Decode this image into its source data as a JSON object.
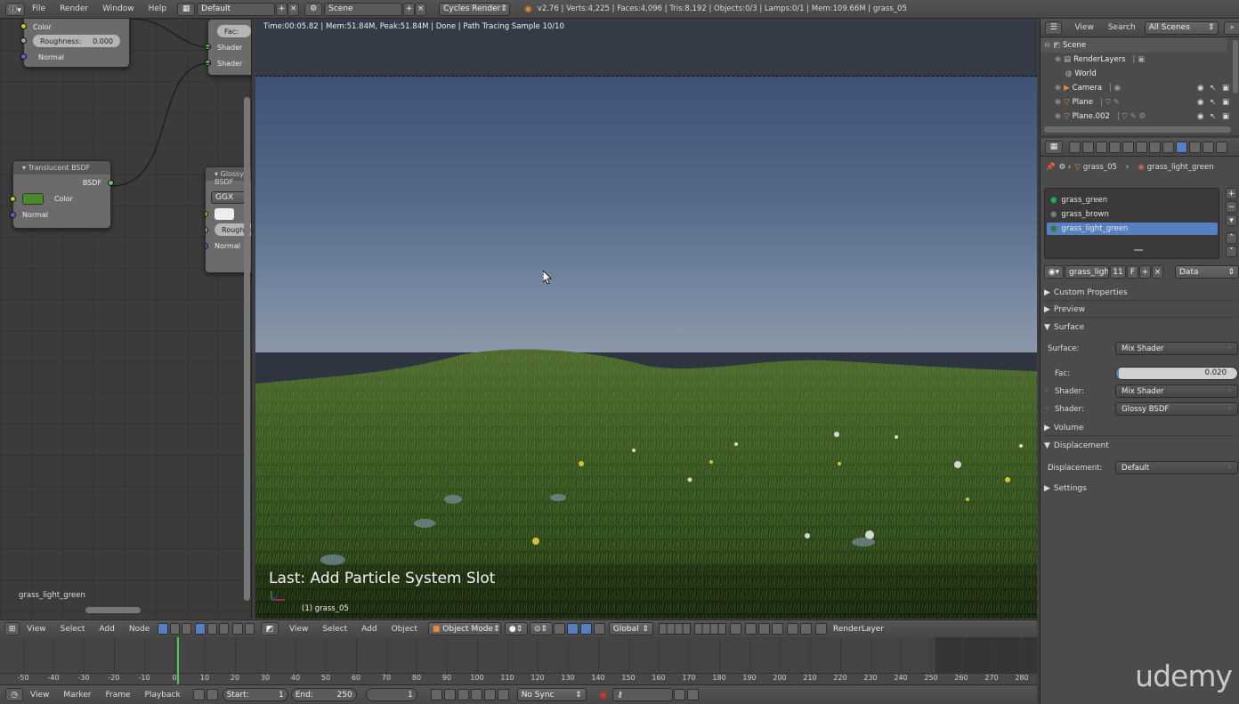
{
  "topbar": {
    "menus": [
      "File",
      "Render",
      "Window",
      "Help"
    ],
    "screen_layout": "Default",
    "scene": "Scene",
    "render_engine": "Cycles Render",
    "stats": "v2.76 | Verts:4,225 | Faces:4,096 | Tris:8,192 | Objects:0/3 | Lamps:0/1 | Mem:109.66M | grass_05"
  },
  "node_editor": {
    "partial_node_1": {
      "color_label": "Color",
      "roughness_label": "Roughness:",
      "roughness_value": "0.000",
      "normal_label": "Normal"
    },
    "mix_node": {
      "fac_label": "Fac:",
      "shader1": "Shader",
      "shader2": "Shader"
    },
    "translucent": {
      "title": "Translucent BSDF",
      "output": "BSDF",
      "color_label": "Color",
      "normal_label": "Normal",
      "color_hex": "#4a8a2a"
    },
    "glossy": {
      "title": "Glossy BSDF",
      "distribution": "GGX",
      "roughness_label": "Roughness",
      "normal_label": "Normal"
    },
    "material_name": "grass_light_green",
    "header": {
      "menus": [
        "View",
        "Select",
        "Add",
        "Node"
      ]
    }
  },
  "viewport": {
    "render_info": "Time:00:05.82 | Mem:51.84M, Peak:51.84M | Done | Path Tracing Sample 10/10",
    "last_operation": "Last: Add Particle System Slot",
    "object_label": "(1) grass_05",
    "header": {
      "menus": [
        "View",
        "Select",
        "Add",
        "Object"
      ],
      "mode": "Object Mode",
      "orientation": "Global",
      "render_layer": "RenderLayer"
    }
  },
  "outliner": {
    "menus": [
      "View",
      "Search"
    ],
    "filter": "All Scenes",
    "items": [
      "Scene",
      "RenderLayers",
      "World",
      "Camera",
      "Plane",
      "Plane.002"
    ]
  },
  "properties": {
    "breadcrumb": [
      "grass_05",
      "grass_light_green"
    ],
    "materials": [
      "grass_green",
      "grass_brown",
      "grass_light_green"
    ],
    "selected_material": "grass_light_green",
    "material_field": "grass_ligh...",
    "users": "11",
    "fake_user": "F",
    "link": "Data",
    "sections": {
      "custom_properties": "Custom Properties",
      "preview": "Preview",
      "surface": "Surface",
      "volume": "Volume",
      "displacement": "Displacement",
      "settings": "Settings"
    },
    "surface_label": "Surface:",
    "surface_value": "Mix Shader",
    "fac_label": "Fac:",
    "fac_value": "0.020",
    "fac_fraction": 0.02,
    "shader1_label": "Shader:",
    "shader1_value": "Mix Shader",
    "shader2_label": "Shader:",
    "shader2_value": "Glossy BSDF",
    "displacement_label": "Displacement:",
    "displacement_value": "Default"
  },
  "timeline": {
    "ticks": [
      "-50",
      "-40",
      "-30",
      "-20",
      "-10",
      "0",
      "10",
      "20",
      "30",
      "40",
      "50",
      "60",
      "70",
      "80",
      "90",
      "100",
      "110",
      "120",
      "130",
      "140",
      "150",
      "160",
      "170",
      "180",
      "190",
      "200",
      "210",
      "220",
      "230",
      "240",
      "250",
      "260",
      "270",
      "280"
    ],
    "menus": [
      "View",
      "Marker",
      "Frame",
      "Playback"
    ],
    "start_label": "Start:",
    "start_value": "1",
    "end_label": "End:",
    "end_value": "250",
    "current_frame": "1",
    "sync": "No Sync"
  },
  "watermark": "udemy"
}
